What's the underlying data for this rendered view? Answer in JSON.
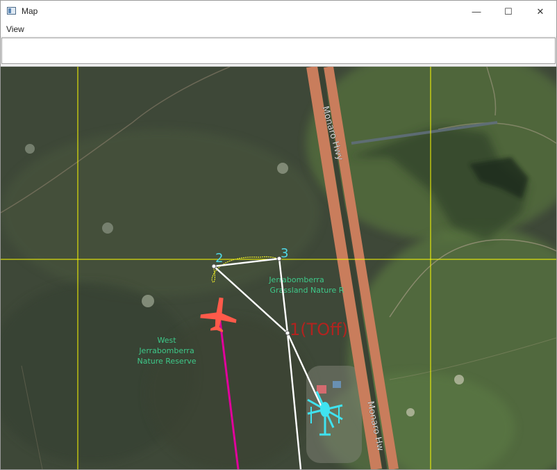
{
  "window": {
    "title": "Map",
    "controls": {
      "minimize": "—",
      "maximize": "☐",
      "close": "✕"
    }
  },
  "menu": {
    "items": [
      {
        "label": "View"
      }
    ]
  },
  "toolbar": {
    "field_value": ""
  },
  "map": {
    "labels": {
      "highway_north": "Monaro Hwy",
      "highway_south": "Monaro Hw",
      "reserve_east_line1": "Jerrabomberra",
      "reserve_east_line2": "Grassland Nature R",
      "reserve_west_line1": "West",
      "reserve_west_line2": "Jerrabomberra",
      "reserve_west_line3": "Nature Reserve"
    },
    "waypoints": [
      {
        "label": "2",
        "color": "#4fd8e6"
      },
      {
        "label": "3",
        "color": "#4fd8e6"
      },
      {
        "label": "1(TOff)",
        "color": "#b2231f"
      }
    ],
    "colors": {
      "grid": "#ffff00",
      "route": "#ffffff",
      "track": "#e0009b",
      "aircraft": "#ff5a4a",
      "helicopter": "#3fe3f0",
      "road": "#c97d5c"
    },
    "icons": {
      "aircraft": "airplane-icon",
      "helicopter": "helicopter-icon"
    }
  }
}
